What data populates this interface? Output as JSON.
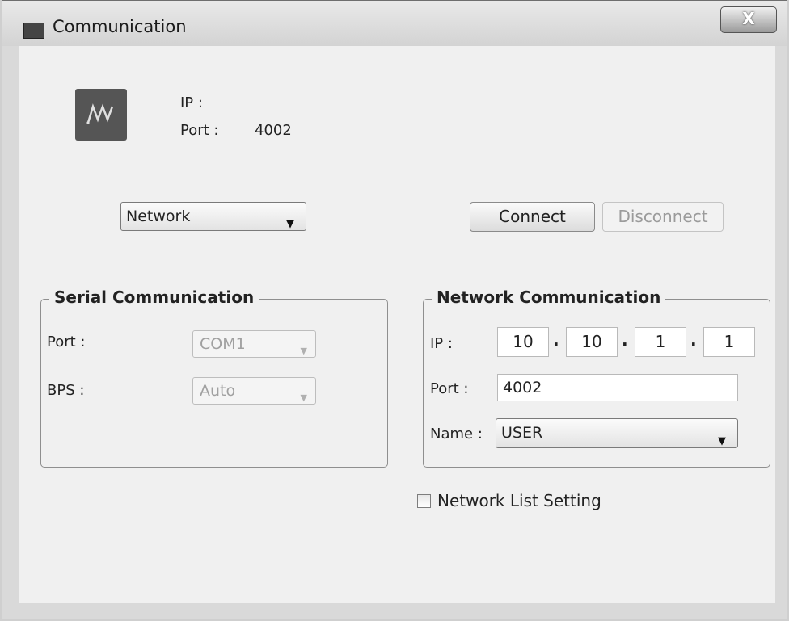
{
  "window": {
    "title": "Communication",
    "close_label": "X"
  },
  "status": {
    "ip_label": "IP :",
    "ip_value": "",
    "port_label": "Port :",
    "port_value": "4002"
  },
  "connection_type": {
    "selected": "Network"
  },
  "buttons": {
    "connect": "Connect",
    "disconnect": "Disconnect"
  },
  "serial": {
    "title": "Serial Communication",
    "port_label": "Port :",
    "port_value": "COM1",
    "bps_label": "BPS :",
    "bps_value": "Auto"
  },
  "network": {
    "title": "Network Communication",
    "ip_label": "IP :",
    "ip": [
      "10",
      "10",
      "1",
      "1"
    ],
    "port_label": "Port :",
    "port_value": "4002",
    "name_label": "Name :",
    "name_value": "USER"
  },
  "network_list": {
    "label": "Network List Setting",
    "checked": false
  },
  "icons": {
    "app": "app-icon",
    "logo": "device-logo-icon",
    "dropdown": "chevron-down-icon"
  }
}
